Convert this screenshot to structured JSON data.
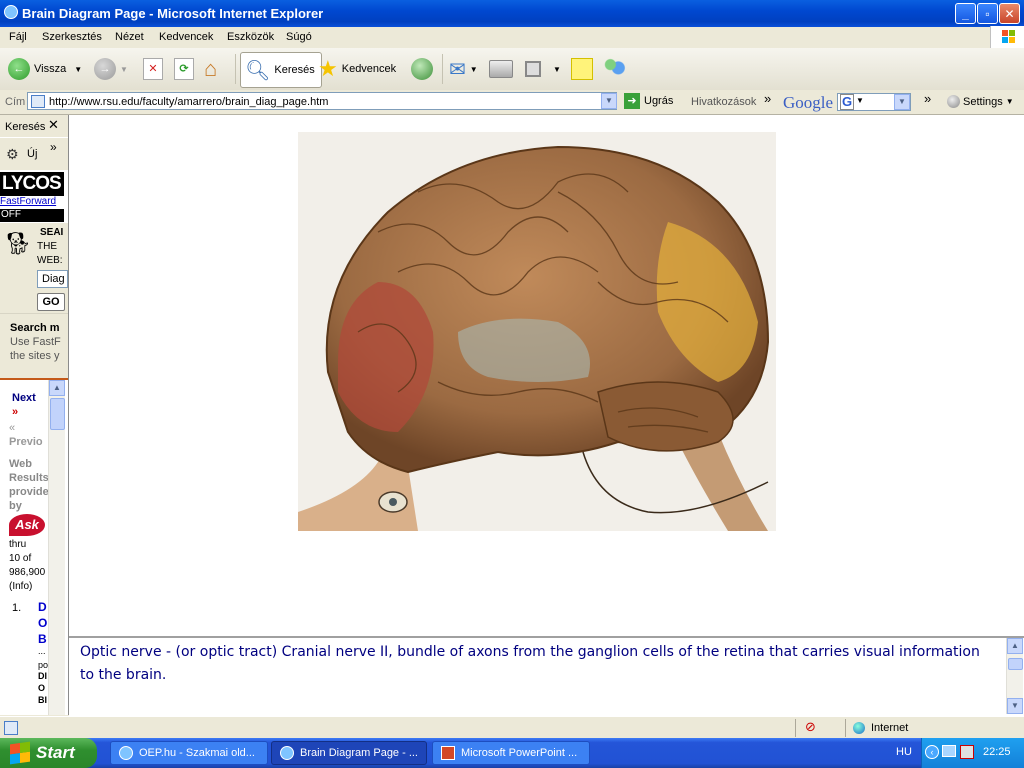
{
  "window": {
    "title": "Brain Diagram Page - Microsoft Internet Explorer"
  },
  "menu": [
    "Fájl",
    "Szerkesztés",
    "Nézet",
    "Kedvencek",
    "Eszközök",
    "Súgó"
  ],
  "toolbar": {
    "back_label": "Vissza",
    "search_label": "Keresés",
    "favorites_label": "Kedvencek"
  },
  "address": {
    "label": "Cím",
    "url": "http://www.rsu.edu/faculty/amarrero/brain_diag_page.htm",
    "go_label": "Ugrás",
    "links_label": "Hivatkozások",
    "google": "Google",
    "google_g": "G",
    "settings_label": "Settings"
  },
  "leftpane": {
    "title": "Keresés",
    "new_label": "Új",
    "lycos": "LYCOS",
    "fastforward": "FastForward",
    "off": "OFF",
    "search_web": [
      "SEAI",
      "THE",
      "WEB:"
    ],
    "query_value": "Diag",
    "go": "GO",
    "search_more": "Search m",
    "use_fast": "Use FastF",
    "the_sites": "the sites y",
    "next": "Next",
    "next_arrow": "»",
    "prev_arrow": "«",
    "previous": "Previo",
    "web_results": [
      "Web",
      "Results",
      "provide",
      "by"
    ],
    "ask": "Ask",
    "thru": [
      "thru",
      "10 of",
      "986,900",
      "(Info)"
    ],
    "result_num": "1.",
    "result_title": [
      "D",
      "O",
      "B"
    ],
    "result_snippet": [
      "...",
      "po",
      "DI",
      "O",
      "BI"
    ]
  },
  "caption": "Optic nerve - (or optic tract) Cranial nerve II, bundle of axons from the ganglion cells of the retina that carries visual information to the brain.",
  "status": {
    "zone": "Internet"
  },
  "taskbar": {
    "start": "Start",
    "tasks": [
      "OEP.hu - Szakmai old...",
      "Brain Diagram Page - ...",
      "Microsoft PowerPoint ..."
    ],
    "lang": "HU",
    "time": "22:25"
  }
}
